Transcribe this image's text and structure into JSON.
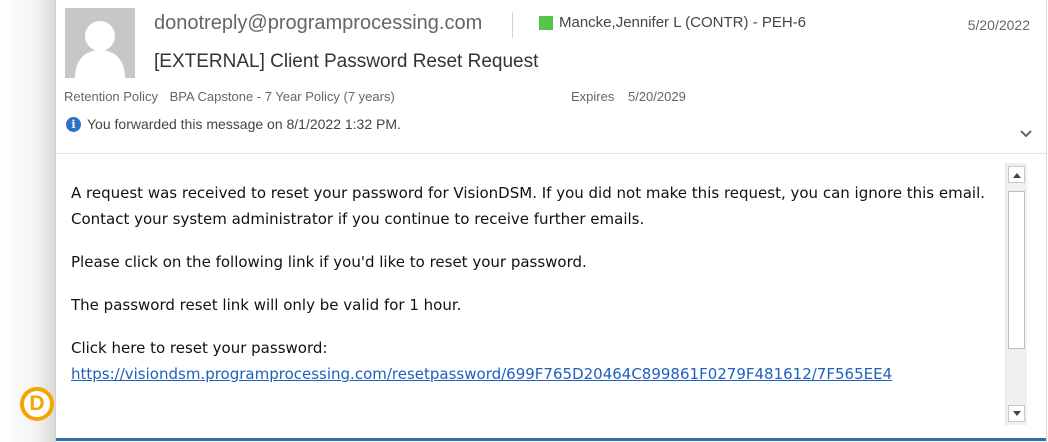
{
  "header": {
    "from": "donotreply@programprocessing.com",
    "to": "Mancke,Jennifer L (CONTR) - PEH-6",
    "date": "5/20/2022",
    "subject": "[EXTERNAL] Client Password Reset Request",
    "retention_label": "Retention Policy",
    "retention_value": "BPA Capstone - 7 Year Policy (7 years)",
    "expires_label": "Expires",
    "expires_value": "5/20/2029",
    "info_message": "You forwarded this message on 8/1/2022 1:32 PM.",
    "presence_color": "#55c54a"
  },
  "body": {
    "paragraph1": "A request was received to reset your password for VisionDSM. If you did not make this request, you can ignore this email.  Contact your system administrator if you continue to receive further emails.",
    "paragraph2": "Please click on the following link if you'd like to reset your password.",
    "paragraph3": "The password reset link will only be valid for 1 hour.",
    "link_intro": "Click here to reset your password:",
    "link_text": "https://visiondsm.programprocessing.com/resetpassword/699F765D20464C899861F0279F481612/7F565EE4"
  },
  "annotation": {
    "marker_label": "D",
    "marker_color": "#f5a400"
  },
  "icons": {
    "avatar": "person-placeholder-icon",
    "info": "info-icon",
    "expand": "chevron-down-icon",
    "scroll_up": "scroll-up-icon",
    "scroll_down": "scroll-down-icon"
  }
}
